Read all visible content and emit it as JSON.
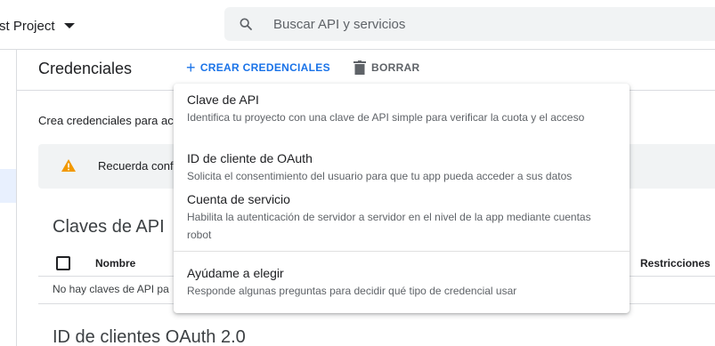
{
  "topbar": {
    "project_name": "rst Project",
    "search_placeholder": "Buscar API y servicios"
  },
  "header": {
    "title": "Credenciales",
    "create_label": "CREAR CREDENCIALES",
    "delete_label": "BORRAR"
  },
  "main": {
    "intro_text": "Crea credenciales para acc",
    "warning_text": "Recuerda confi",
    "api_keys_title": "Claves de API",
    "columns": [
      "Nombre",
      "Restricciones"
    ],
    "empty_text": "No hay claves de API pa",
    "oauth_title": "ID de clientes OAuth 2.0"
  },
  "menu": {
    "items": [
      {
        "title": "Clave de API",
        "description": "Identifica tu proyecto con una clave de API simple para verificar la cuota y el acceso"
      },
      {
        "title": "ID de cliente de OAuth",
        "description": "Solicita el consentimiento del usuario para que tu app pueda acceder a sus datos"
      },
      {
        "title": "Cuenta de servicio",
        "description": "Habilita la autenticación de servidor a servidor en el nivel de la app mediante cuentas robot"
      },
      {
        "title": "Ayúdame a elegir",
        "description": "Responde algunas preguntas para decidir qué tipo de credencial usar"
      }
    ]
  },
  "colors": {
    "accent": "#1a73e8",
    "warning": "#f29900"
  }
}
